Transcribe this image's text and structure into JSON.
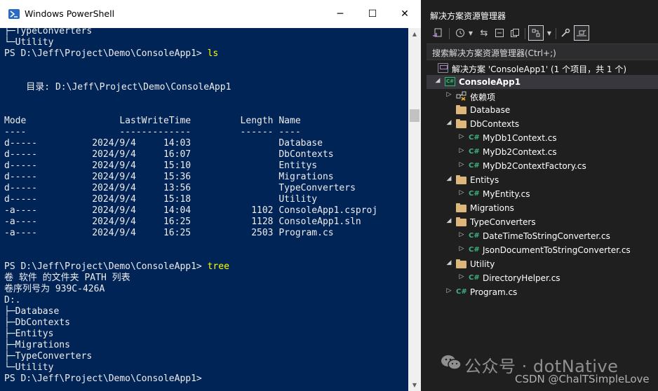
{
  "powershell": {
    "title": "Windows PowerShell",
    "window_controls": {
      "minimize": "─",
      "maximize": "☐",
      "close": "✕"
    },
    "lines": [
      {
        "text": "├─TypeConverters"
      },
      {
        "text": "└─Utility"
      },
      {
        "prompt": "PS D:\\Jeff\\Project\\Demo\\ConsoleApp1> ",
        "command": "ls"
      },
      {
        "text": ""
      },
      {
        "text": ""
      },
      {
        "text": "    目录: D:\\Jeff\\Project\\Demo\\ConsoleApp1"
      },
      {
        "text": ""
      },
      {
        "text": ""
      },
      {
        "text": "Mode                 LastWriteTime         Length Name"
      },
      {
        "text": "----                 -------------         ------ ----"
      },
      {
        "text": "d-----          2024/9/4     14:03                Database"
      },
      {
        "text": "d-----          2024/9/4     16:07                DbContexts"
      },
      {
        "text": "d-----          2024/9/4     15:10                Entitys"
      },
      {
        "text": "d-----          2024/9/4     15:36                Migrations"
      },
      {
        "text": "d-----          2024/9/4     13:56                TypeConverters"
      },
      {
        "text": "d-----          2024/9/4     15:18                Utility"
      },
      {
        "text": "-a----          2024/9/4     14:04           1102 ConsoleApp1.csproj"
      },
      {
        "text": "-a----          2024/9/4     16:25           1128 ConsoleApp1.sln"
      },
      {
        "text": "-a----          2024/9/4     16:25           2503 Program.cs"
      },
      {
        "text": ""
      },
      {
        "text": ""
      },
      {
        "prompt": "PS D:\\Jeff\\Project\\Demo\\ConsoleApp1> ",
        "command": "tree"
      },
      {
        "text": "卷 软件 的文件夹 PATH 列表"
      },
      {
        "text": "卷序列号为 939C-426A"
      },
      {
        "text": "D:."
      },
      {
        "text": "├─Database"
      },
      {
        "text": "├─DbContexts"
      },
      {
        "text": "├─Entitys"
      },
      {
        "text": "├─Migrations"
      },
      {
        "text": "├─TypeConverters"
      },
      {
        "text": "└─Utility"
      },
      {
        "prompt": "PS D:\\Jeff\\Project\\Demo\\ConsoleApp1> ",
        "command": ""
      }
    ],
    "colors": {
      "background": "#012456",
      "text": "#eeedf0",
      "command": "#ffff00"
    }
  },
  "solution_explorer": {
    "title": "解决方案资源管理器",
    "search_placeholder": "搜索解决方案资源管理器(Ctrl+;)",
    "toolbar_icons": [
      "switch-views-icon",
      "history-icon",
      "dropdown-icon",
      "sync-icon",
      "collapse-all-icon",
      "copy-icon",
      "filter-icon",
      "dropdown-icon",
      "properties-icon",
      "preview-icon"
    ],
    "tree": [
      {
        "label": "解决方案 'ConsoleApp1' (1 个项目，共 1 个)",
        "icon": "solution-icon",
        "level": 0,
        "expander": ""
      },
      {
        "label": "ConsoleApp1",
        "icon": "csproj-icon",
        "level": 0,
        "expander": "expanded",
        "bold": true,
        "selected": true
      },
      {
        "label": "依赖项",
        "icon": "dependencies-icon",
        "level": 1,
        "expander": "collapsed"
      },
      {
        "label": "Database",
        "icon": "folder-icon",
        "level": 1,
        "expander": ""
      },
      {
        "label": "DbContexts",
        "icon": "folder-icon",
        "level": 1,
        "expander": "expanded"
      },
      {
        "label": "MyDb1Context.cs",
        "icon": "csharp-file-icon",
        "level": 2,
        "expander": "collapsed"
      },
      {
        "label": "MyDb2Context.cs",
        "icon": "csharp-file-icon",
        "level": 2,
        "expander": "collapsed"
      },
      {
        "label": "MyDb2ContextFactory.cs",
        "icon": "csharp-file-icon",
        "level": 2,
        "expander": "collapsed"
      },
      {
        "label": "Entitys",
        "icon": "folder-icon",
        "level": 1,
        "expander": "expanded"
      },
      {
        "label": "MyEntity.cs",
        "icon": "csharp-file-icon",
        "level": 2,
        "expander": "collapsed"
      },
      {
        "label": "Migrations",
        "icon": "folder-icon",
        "level": 1,
        "expander": ""
      },
      {
        "label": "TypeConverters",
        "icon": "folder-icon",
        "level": 1,
        "expander": "expanded"
      },
      {
        "label": "DateTimeToStringConverter.cs",
        "icon": "csharp-file-icon",
        "level": 2,
        "expander": "collapsed"
      },
      {
        "label": "JsonDocumentToStringConverter.cs",
        "icon": "csharp-file-icon",
        "level": 2,
        "expander": "collapsed"
      },
      {
        "label": "Utility",
        "icon": "folder-icon",
        "level": 1,
        "expander": "expanded"
      },
      {
        "label": "DirectoryHelper.cs",
        "icon": "csharp-file-icon",
        "level": 2,
        "expander": "collapsed"
      },
      {
        "label": "Program.cs",
        "icon": "csharp-file-icon",
        "level": 1,
        "expander": "collapsed"
      }
    ],
    "colors": {
      "background": "#1f1f1f",
      "folder": "#dcb67a",
      "csharp": "#3fb37f",
      "selected_row": "#37373d"
    }
  },
  "watermarks": {
    "wechat": "公众号 · dotNative",
    "csdn": "CSDN @ChalTSimpleLove"
  }
}
